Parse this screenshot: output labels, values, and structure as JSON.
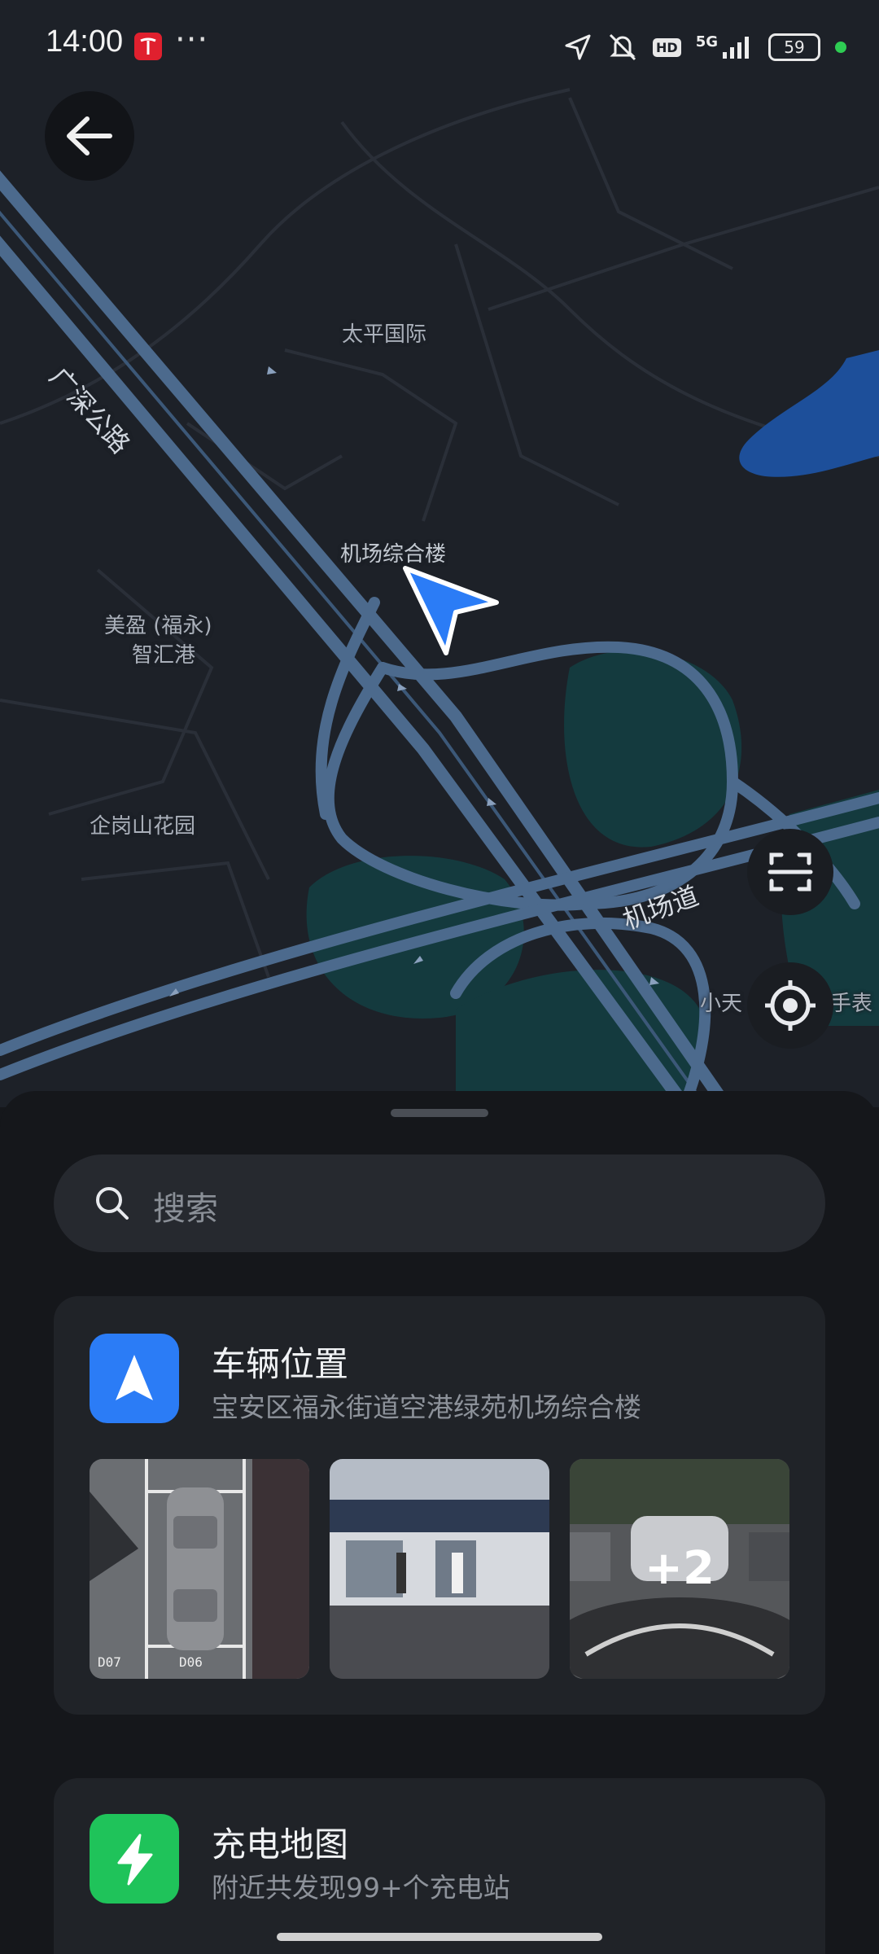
{
  "status_bar": {
    "time": "14:00",
    "network": "5G",
    "hd": "HD",
    "battery": "59"
  },
  "map": {
    "labels": {
      "guangshen_road": "广深公路",
      "taiping": "太平国际",
      "airport_building": "机场综合楼",
      "meiying_1": "美盈 (福永)",
      "meiying_2": "智汇港",
      "qigang": "企岗山花园",
      "airport_road": "机场道",
      "xiaotian": "小天",
      "shoubiao": "手表"
    }
  },
  "search": {
    "placeholder": "搜索"
  },
  "vehicle_card": {
    "title": "车辆位置",
    "address": "宝安区福永街道空港绿苑机场综合楼",
    "extra_photos": "+2",
    "photo_labels": [
      "D07",
      "D06"
    ]
  },
  "charging_card": {
    "title": "充电地图",
    "subtitle": "附近共发现99+个充电站"
  },
  "colors": {
    "accent_blue": "#2b7cf6",
    "charging_green": "#1fc35a",
    "road": "#4c6a8d",
    "water": "#1d4f9a",
    "green_area": "#143a3e"
  }
}
